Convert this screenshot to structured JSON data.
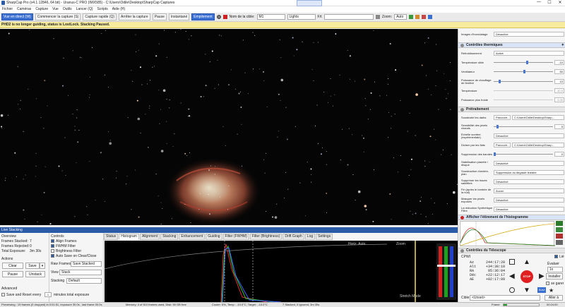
{
  "window": {
    "title": "SharpCap Pro (v4.1.12846, 64 bit) - Uranus-C PRO (IMX585) - C:\\Users\\Odile\\Desktop\\SharpCap Captures",
    "min": "—",
    "max": "☐",
    "close": "✕"
  },
  "menu": [
    "Fichier",
    "Caméras",
    "Capture",
    "Vue",
    "Outils",
    "Lancer (Q)",
    "Scripts",
    "Aide (H)"
  ],
  "toolbar": {
    "live_view": "Vue en direct (W)",
    "start_capture": "Commencer la capture (S)",
    "quick_capture": "Capture rapide (Q)",
    "stop_capture": "Arrêter la capture",
    "pause": "Pause",
    "snapshot": "Instantané",
    "stacking": "Empilement",
    "target_label": "Nom de la cible:",
    "target_value": "M1",
    "frame_type": "Lights",
    "fx_label": "FX",
    "zoom_label": "Zoom:",
    "zoom_value": "Auto"
  },
  "alert": "PHD2 is no longer guiding, status is LostLock. Stacking Paused.",
  "panel": {
    "row_first": {
      "label": "Images d'horodatage",
      "value": "Désactivé"
    },
    "thermal": {
      "title": "Contrôles thermiques",
      "rows": [
        {
          "label": "Refroidissement",
          "value": "Activé"
        },
        {
          "label": "Température cible",
          "value": "-10"
        },
        {
          "label": "Ventilateur",
          "value": "50"
        },
        {
          "label": "Puissance de chauffage de fenêtre",
          "value": "10"
        },
        {
          "label": "Température",
          "value": "-10.0"
        },
        {
          "label": "Puissance plus froide",
          "value": "5.00"
        }
      ]
    },
    "pre": {
      "title": "Prétraitement",
      "rows": [
        {
          "label": "Soustraire les darks",
          "button": "Parcourir...",
          "value": "C:\\Users\\Odile\\Desktop\\Sharp..."
        },
        {
          "label": "Sensibilité des pixels chauds",
          "value": "5"
        },
        {
          "label": "Échelle sombre (expérimentale)",
          "value": "Désactivé"
        },
        {
          "label": "Diviser par les flats",
          "button": "Parcourir...",
          "value": "C:\\Users\\Odile\\Desktop\\Sharp..."
        },
        {
          "label": "Suppression des bandes",
          "value": "0"
        },
        {
          "label": "Stabilisation planète / disque",
          "value": "Désactivé"
        },
        {
          "label": "Soustraction d'arrière-plan",
          "value": "Suppression du dégradé linéaire"
        },
        {
          "label": "Supprimer les traces satellites",
          "value": "Désactivé"
        },
        {
          "label": "Fin (après le tombée de la nuit)",
          "value": "Aucun"
        },
        {
          "label": "Masquer les pixels exposés",
          "value": "Désactivé"
        },
        {
          "label": "La réduction Synthétique Filtre",
          "value": "Désactivé"
        }
      ]
    },
    "histogram": {
      "title": "Afficher l'étirement de l'histogramme"
    },
    "telescope": {
      "title": "Contrôles du Télescope",
      "driver": "CPWI",
      "track_label": "Lié",
      "eval_label": "Évaluer",
      "eval_value": "1x",
      "install": "Installer",
      "park": "se garer",
      "follow": "Suivi",
      "stop_button": "STOP",
      "target_label": "Cible",
      "target_value": "<Unset>",
      "goto": "Aller à",
      "coords": [
        {
          "k": "Az",
          "v": "244:17:28"
        },
        {
          "k": "Alt",
          "v": "+34:38:18"
        },
        {
          "k": "RA",
          "v": "05:36:04"
        },
        {
          "k": "Déc",
          "v": "+22:12:17"
        },
        {
          "k": "AE",
          "v": "+02:17:09"
        }
      ]
    }
  },
  "ls": {
    "title": "Live Stacking",
    "overview_title": "Overview",
    "frames_stacked_label": "Frames Stacked:",
    "frames_stacked": "7",
    "frames_rejected_label": "Frames Rejected:",
    "frames_rejected": "0",
    "total_exposure_label": "Total Exposure:",
    "total_exposure": "3m 30s",
    "actions_title": "Actions",
    "clear": "Clear",
    "save": "Save",
    "pause": "Pause",
    "unstack": "Unstack",
    "advanced": "Advanced",
    "save_reset": "Save and Reset every",
    "minutes": "minutes total exposure",
    "minutes_value": "1",
    "controls_title": "Controls",
    "align": "Align Frames",
    "fwhm": "FWHM Filter",
    "brightness": "Brightness Filter",
    "autosave": "Auto Save on Clear/Close",
    "raw_frames": "Raw Frames",
    "raw_value": "Save Stacked",
    "view_label": "View",
    "view_value": "Stack",
    "stacking_label": "Stacking",
    "stacking_value": "Default",
    "tabs": [
      "Status",
      "Histogram",
      "Alignment",
      "Stacking",
      "Enhancement",
      "Guiding",
      "Filter (FWHM)",
      "Filter (Brightness)",
      "Drift Graph",
      "Log",
      "Settings"
    ],
    "hist_opts": "Horiz. Auto",
    "hist_zoom": "Zoom",
    "stretch_label": "Stretch Mode"
  },
  "status": {
    "left": "Previewing : 19 frames (0 dropped) in 0:01:51, exposure 30.0s , last frame 00.0s",
    "mem": "Memory: 4 of 510 frames used, Disk: 50 GB free",
    "cooler": "Cooler: 5%, Temp : -10.0°C, Target : -10.0°C",
    "stack": "7 Stacked, 0 Ignored, 3m 30s",
    "frame_label": "Frame",
    "time": "00:24:00"
  },
  "colors": {
    "accent": "#2b5aa7",
    "alert": "#f7ec9e",
    "sky": "#050505",
    "stop": "#e02020"
  }
}
